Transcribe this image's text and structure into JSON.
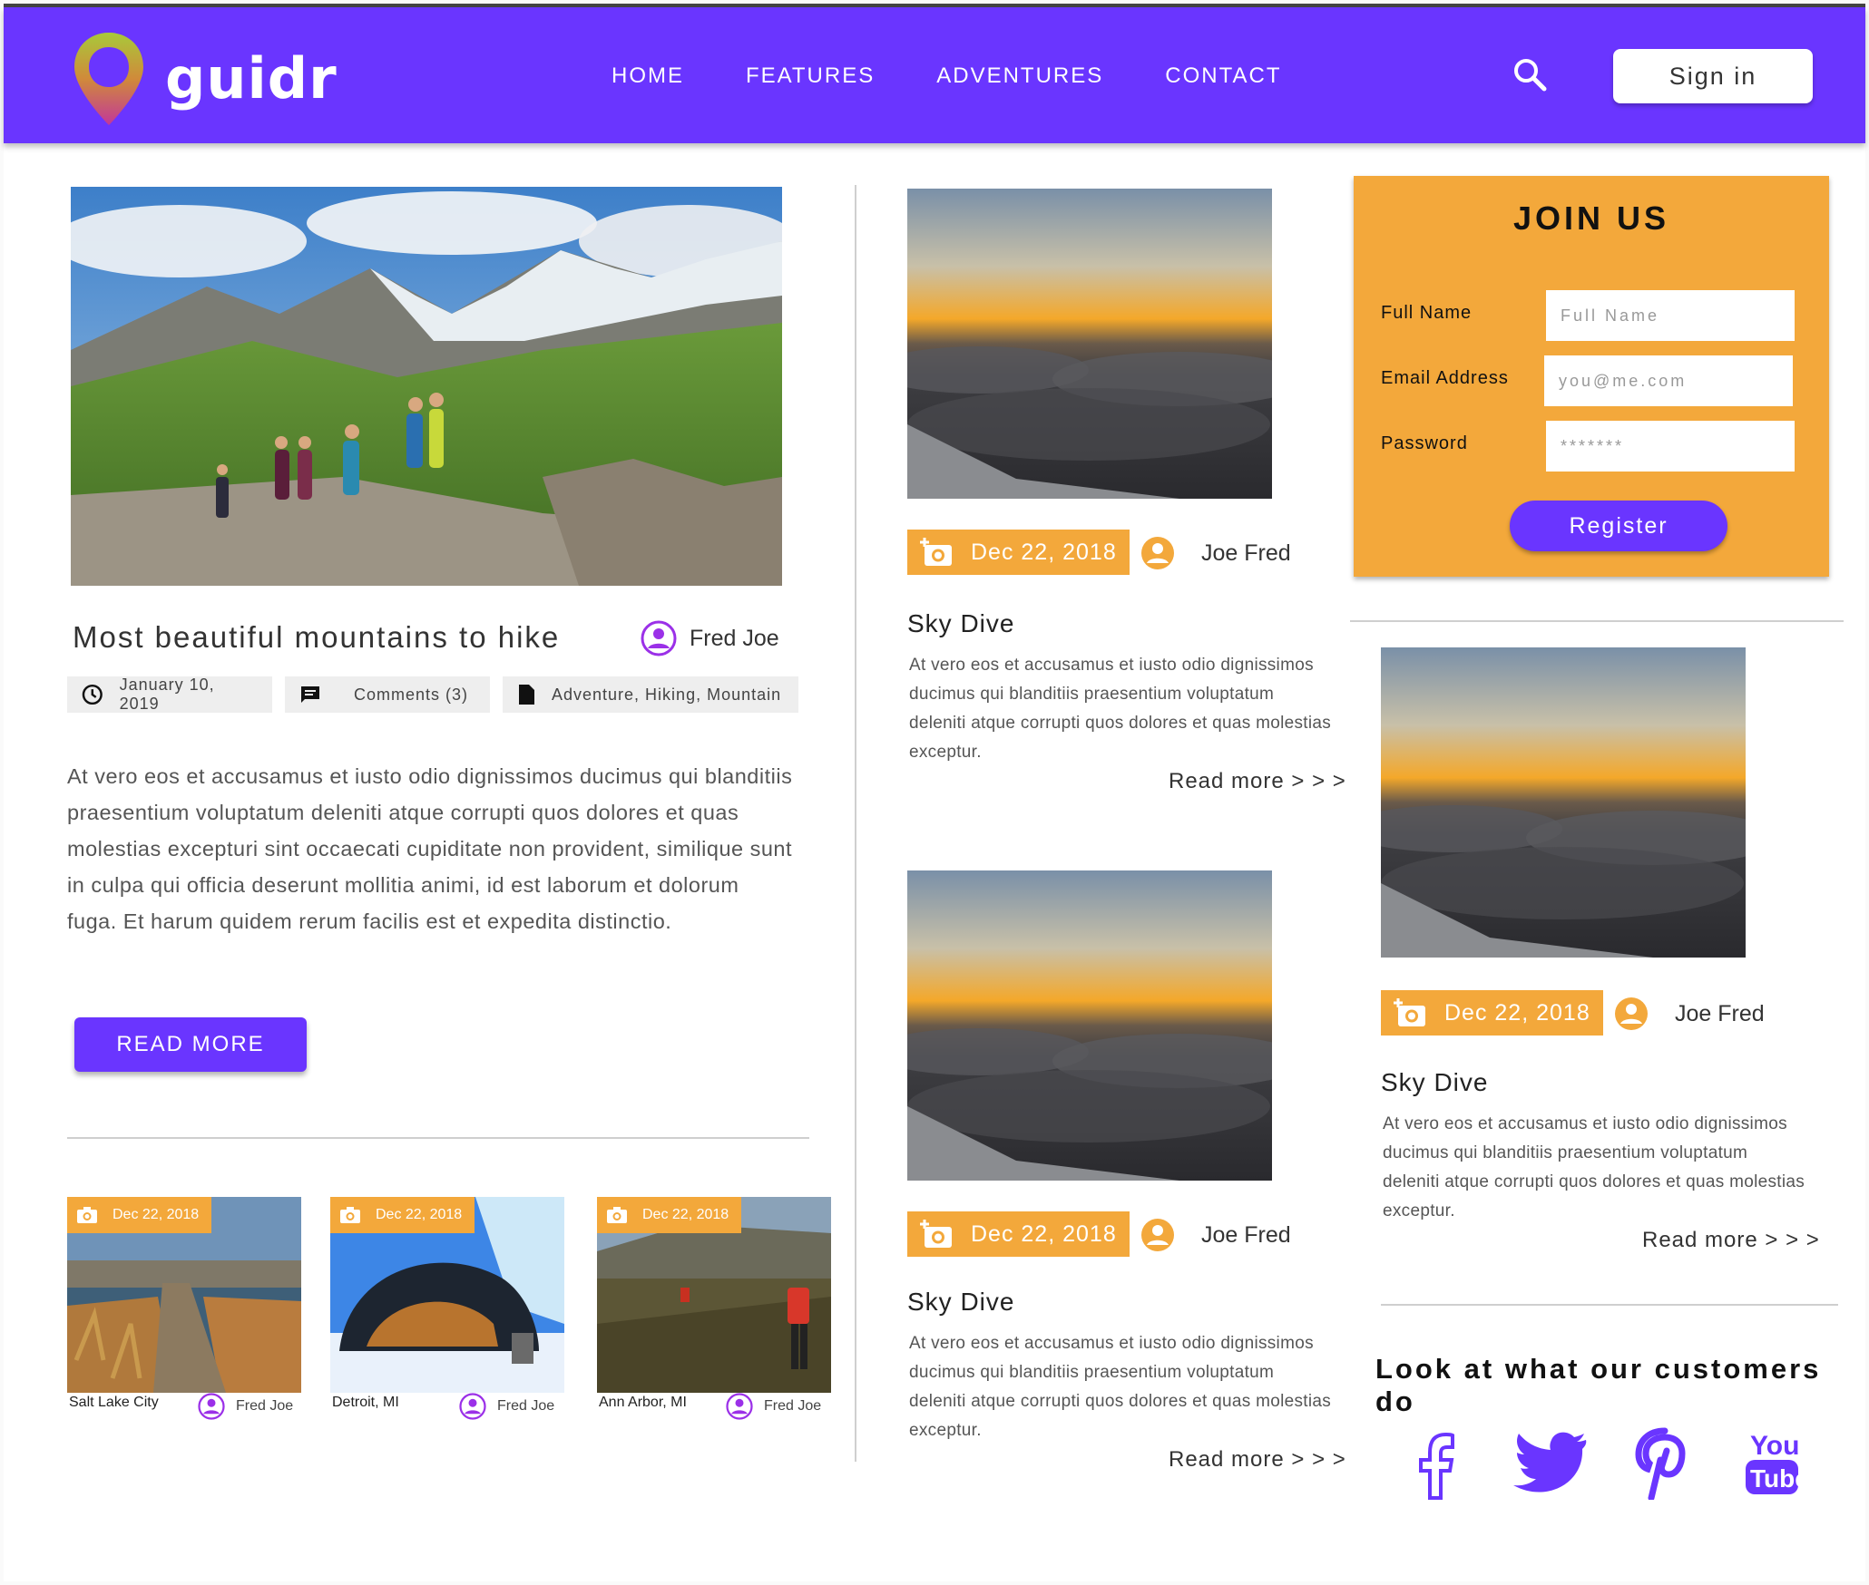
{
  "header": {
    "logo_text": "guidr",
    "nav": [
      "HOME",
      "FEATURES",
      "ADVENTURES",
      "CONTACT"
    ],
    "sign_in": "Sign in"
  },
  "colors": {
    "brand": "#6a35ff",
    "accent": "#f3a83b"
  },
  "featured": {
    "title": "Most beautiful mountains to hike",
    "author": "Fred Joe",
    "date": "January 10, 2019",
    "comments": "Comments (3)",
    "tags": "Adventure, Hiking, Mountain",
    "body": "At vero eos et accusamus et iusto odio dignissimos ducimus qui blanditiis praesentium voluptatum deleniti atque corrupti quos dolores et quas molestias excepturi sint occaecati cupiditate non provident, similique sunt in culpa qui officia deserunt mollitia animi, id est laborum et dolorum fuga. Et harum quidem rerum facilis est et expedita distinctio.",
    "read_more": "READ MORE"
  },
  "thumbs": [
    {
      "date": "Dec 22, 2018",
      "location": "Salt Lake City",
      "author": "Fred Joe"
    },
    {
      "date": "Dec 22, 2018",
      "location": "Detroit, MI",
      "author": "Fred Joe"
    },
    {
      "date": "Dec 22, 2018",
      "location": "Ann Arbor, MI",
      "author": "Fred Joe"
    }
  ],
  "posts": [
    {
      "date": "Dec 22, 2018",
      "author": "Joe Fred",
      "title": "Sky Dive",
      "text": "At vero eos et accusamus et iusto odio dignissimos ducimus qui blanditiis praesentium voluptatum deleniti atque corrupti quos dolores et quas molestias exceptur.",
      "more": "Read more > > >"
    },
    {
      "date": "Dec 22, 2018",
      "author": "Joe Fred",
      "title": "Sky Dive",
      "text": "At vero eos et accusamus et iusto odio dignissimos ducimus qui blanditiis praesentium voluptatum deleniti atque corrupti quos dolores et quas molestias exceptur.",
      "more": "Read more > > >"
    },
    {
      "date": "Dec 22, 2018",
      "author": "Joe Fred",
      "title": "Sky Dive",
      "text": "At vero eos et accusamus et iusto odio dignissimos ducimus qui blanditiis praesentium voluptatum deleniti atque corrupti quos dolores et quas molestias exceptur.",
      "more": "Read more > > >"
    }
  ],
  "join": {
    "title": "JOIN US",
    "full_name_label": "Full Name",
    "full_name_placeholder": "Full Name",
    "email_label": "Email Address",
    "email_placeholder": "you@me.com",
    "password_label": "Password",
    "password_placeholder": "*******",
    "register": "Register"
  },
  "customers": {
    "title": "Look at what our customers do",
    "icons": [
      "facebook-icon",
      "twitter-icon",
      "pinterest-icon",
      "youtube-icon"
    ]
  }
}
